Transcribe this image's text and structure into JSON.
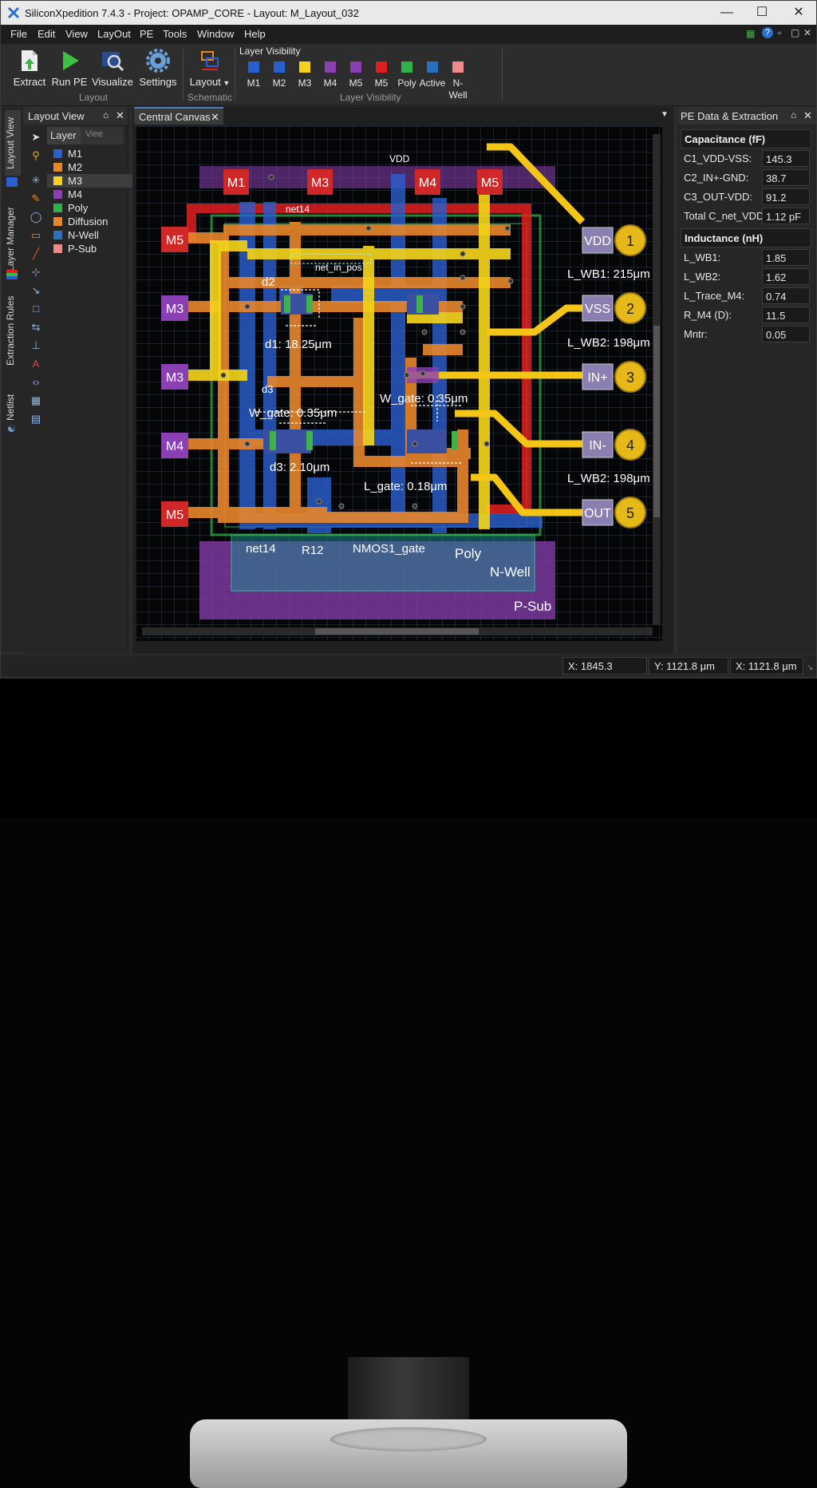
{
  "window": {
    "title": "SiliconXpedition 7.4.3 - Project: OPAMP_CORE - Layout: M_Layout_032"
  },
  "menu": [
    "File",
    "Edit",
    "View",
    "LayOut",
    "PE",
    "Tools",
    "Window",
    "Help"
  ],
  "toolbar": {
    "buttons": [
      {
        "label": "Extract",
        "icon": "extract-icon"
      },
      {
        "label": "Run PE",
        "icon": "play-icon"
      },
      {
        "label": "Visualize",
        "icon": "visualize-icon"
      },
      {
        "label": "Settings",
        "icon": "gear-icon"
      }
    ],
    "group_layout": "Layout",
    "schematic_button": "Layout",
    "group_schematic": "Schematic",
    "visibility_title": "Layer Visibility",
    "group_visibility": "Layer Visibility",
    "visibility": [
      {
        "label": "M1",
        "color": "#2a5fd0"
      },
      {
        "label": "M2",
        "color": "#2a5fd0"
      },
      {
        "label": "M3",
        "color": "#f2d21b"
      },
      {
        "label": "M4",
        "color": "#8a3fb2"
      },
      {
        "label": "M5",
        "color": "#8a3fb2"
      },
      {
        "label": "M5",
        "color": "#e02020"
      },
      {
        "label": "Poly",
        "color": "#2fb24a"
      },
      {
        "label": "Active",
        "color": "#2a6fc0"
      },
      {
        "label": "N-Well",
        "color": "#f08a8a"
      }
    ]
  },
  "vtabs": [
    "Layout View",
    "Layer Manager",
    "Extraction Rules",
    "Netlist"
  ],
  "left_panel": {
    "title": "Layout View",
    "tab_layer": "Layer",
    "tab_view": "Viее",
    "layers": [
      {
        "name": "M1",
        "color": "#2a5fd0"
      },
      {
        "name": "M2",
        "color": "#e8862a"
      },
      {
        "name": "M3",
        "color": "#f2d21b"
      },
      {
        "name": "M4",
        "color": "#8a3fb2"
      },
      {
        "name": "Poly",
        "color": "#2fb24a"
      },
      {
        "name": "Diffusion",
        "color": "#e8862a"
      },
      {
        "name": "N-Well",
        "color": "#2a6fc0"
      },
      {
        "name": "P-Sub",
        "color": "#f08a8a"
      }
    ]
  },
  "canvas_tab": "Central Canvas",
  "canvas": {
    "vdd_top": "VDD",
    "net14_top": "net14",
    "net_in_pos": "net_in_pos",
    "d2": "d2",
    "d1": "d1: 18.25μm",
    "d3_small": "d3",
    "w_gate_left": "W_gate: 0.35μm",
    "w_gate_right": "W_gate: 0.35μm",
    "d3": "d3: 2.10μm",
    "l_gate": "L_gate: 0.18μm",
    "bottom_labels": [
      "net14",
      "R12",
      "NMOS1_gate",
      "Poly"
    ],
    "n_well": "N-Well",
    "p_sub": "P-Sub",
    "top_boxes": [
      "M1",
      "M3",
      "M4",
      "M5"
    ],
    "left_boxes": [
      "M5",
      "M3",
      "M3",
      "M4",
      "M5"
    ],
    "pins": [
      {
        "name": "VDD",
        "num": "1",
        "below": "L_WB1: 215μm"
      },
      {
        "name": "VSS",
        "num": "2",
        "below": "L_WB2: 198μm"
      },
      {
        "name": "IN+",
        "num": "3",
        "below": ""
      },
      {
        "name": "IN-",
        "num": "4",
        "below": "L_WB2: 198μm"
      },
      {
        "name": "OUT",
        "num": "5",
        "below": ""
      }
    ]
  },
  "right_panel": {
    "title": "PE Data & Extraction",
    "cap_title": "Capacitance (fF)",
    "cap": [
      {
        "k": "C1_VDD-VSS:",
        "v": "145.3"
      },
      {
        "k": "C2_IN+-GND:",
        "v": "38.7"
      },
      {
        "k": "C3_OUT-VDD:",
        "v": "91.2"
      },
      {
        "k": "Total C_net_VDD:",
        "v": "1.12 pF"
      }
    ],
    "ind_title": "Inductance (nH)",
    "ind": [
      {
        "k": "L_WB1:",
        "v": "1.85"
      },
      {
        "k": "L_WB2:",
        "v": "1.62"
      },
      {
        "k": "L_Trace_M4:",
        "v": "0.74"
      },
      {
        "k": "R_M4 (D):",
        "v": "11.5"
      },
      {
        "k": "Mntr:",
        "v": "0.05"
      }
    ]
  },
  "status": [
    "X: 1845.3",
    "Y: 1121.8 μm",
    "X: 1121.8 μm"
  ]
}
